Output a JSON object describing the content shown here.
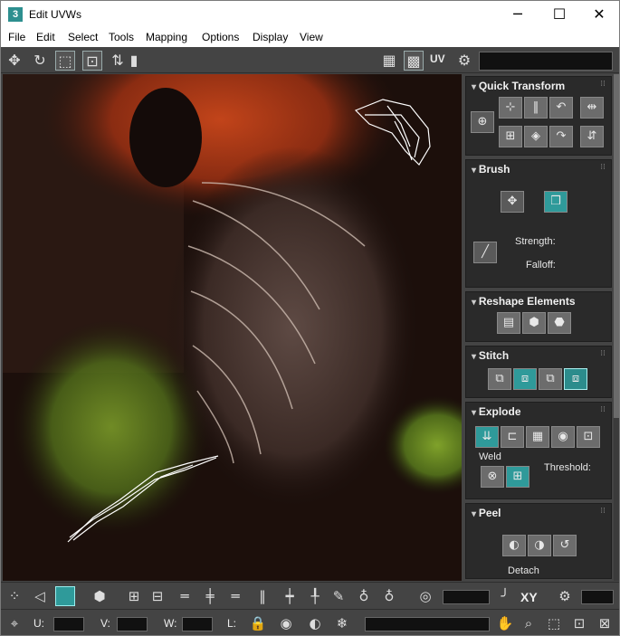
{
  "window": {
    "title": "Edit UVWs",
    "app_icon_glyph": "3",
    "controls": {
      "minimize": "─",
      "maximize": "☐",
      "close": "✕"
    }
  },
  "menu": [
    "File",
    "Edit",
    "Select",
    "Tools",
    "Mapping",
    "Options",
    "Display",
    "View"
  ],
  "top_toolbar": {
    "uv_label": "UV",
    "map_dropdown_value": ""
  },
  "panel": {
    "quick_transform": {
      "title": "Quick Transform"
    },
    "brush": {
      "title": "Brush",
      "strength_label": "Strength:",
      "falloff_label": "Falloff:"
    },
    "reshape": {
      "title": "Reshape Elements"
    },
    "stitch": {
      "title": "Stitch"
    },
    "explode": {
      "title": "Explode",
      "weld_label": "Weld",
      "threshold_label": "Threshold:"
    },
    "peel": {
      "title": "Peel",
      "detach_label": "Detach"
    }
  },
  "bottom1": {
    "xy_label": "XY",
    "field_a": "",
    "field_b": ""
  },
  "bottom2": {
    "u_label": "U:",
    "v_label": "V:",
    "w_label": "W:",
    "l_label": "L:",
    "u_value": "",
    "v_value": "",
    "w_value": "",
    "l_value": ""
  },
  "colors": {
    "accent_teal": "#2f9a9a",
    "panel_bg": "#2a2a2a",
    "chrome": "#444444"
  },
  "icons": {
    "move": "move-icon",
    "rotate": "rotate-icon",
    "freeform": "freeform-icon",
    "checker": "checker-icon",
    "settings": "settings-icon",
    "pan": "hand-icon",
    "zoom": "zoom-icon",
    "snowflake": "freeze-icon",
    "lock": "lock-icon"
  }
}
